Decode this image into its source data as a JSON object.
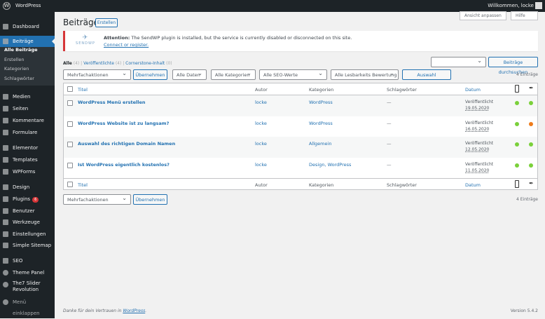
{
  "adminbar": {
    "site": "WordPress",
    "welcome": "Willkommen, locke"
  },
  "sidebar": {
    "items": [
      {
        "label": "Dashboard",
        "icon": "dashboard-icon"
      },
      {
        "label": "Beiträge",
        "icon": "pin-icon",
        "active": true
      },
      {
        "label": "Medien",
        "icon": "media-icon"
      },
      {
        "label": "Seiten",
        "icon": "page-icon"
      },
      {
        "label": "Kommentare",
        "icon": "comment-icon"
      },
      {
        "label": "Formulare",
        "icon": "form-icon"
      },
      {
        "label": "Elementor",
        "icon": "elementor-icon"
      },
      {
        "label": "Templates",
        "icon": "folder-icon"
      },
      {
        "label": "WPForms",
        "icon": "wpforms-icon"
      },
      {
        "label": "Design",
        "icon": "brush-icon"
      },
      {
        "label": "Plugins",
        "icon": "plugin-icon",
        "badge": "6"
      },
      {
        "label": "Benutzer",
        "icon": "user-icon"
      },
      {
        "label": "Werkzeuge",
        "icon": "wrench-icon"
      },
      {
        "label": "Einstellungen",
        "icon": "settings-icon"
      },
      {
        "label": "Simple Sitemap",
        "icon": "sitemap-icon"
      },
      {
        "label": "SEO",
        "icon": "seo-icon"
      },
      {
        "label": "Theme Panel",
        "icon": "gear-icon"
      },
      {
        "label": "The7 Slider Revolution",
        "icon": "slider-icon"
      },
      {
        "label": "Menü einklappen",
        "icon": "collapse-icon"
      }
    ],
    "submenu": [
      "Alle Beiträge",
      "Erstellen",
      "Kategorien",
      "Schlagwörter"
    ]
  },
  "header": {
    "title": "Beiträge",
    "add_new": "Erstellen",
    "screen_options": "Ansicht anpassen",
    "help": "Hilfe"
  },
  "notice": {
    "logo": "SENDWP",
    "strong": "Attention:",
    "text": "The SendWP plugin is installed, but the service is currently disabled or disconnected on this site.",
    "link": "Connect or register."
  },
  "views": [
    {
      "label": "Alle",
      "count": "(4)"
    },
    {
      "label": "Veröffentlichte",
      "count": "(4)"
    },
    {
      "label": "Cornerstone-Inhalt",
      "count": "(0)"
    }
  ],
  "search": {
    "value": "",
    "button": "Beiträge durchsuchen"
  },
  "filters": {
    "bulk": "Mehrfachaktionen",
    "apply": "Übernehmen",
    "dates": "Alle Daten",
    "cats": "Alle Kategorien",
    "seo": "Alle SEO-Werte",
    "readability": "Alle Lesbarkeits Bewertung",
    "filter": "Auswahl einschränken",
    "count": "4 Einträge"
  },
  "columns": {
    "title": "Titel",
    "author": "Autor",
    "categories": "Kategorien",
    "tags": "Schlagwörter",
    "date": "Datum"
  },
  "rows": [
    {
      "title": "WordPress Menü erstellen",
      "author": "locke",
      "categories": "WordPress",
      "tags": "—",
      "status": "Veröffentlicht",
      "date": "19.05.2020",
      "seo": "#7ad03a",
      "readability": "#7ad03a"
    },
    {
      "title": "WordPress Website ist zu langsam?",
      "author": "locke",
      "categories": "WordPress",
      "tags": "—",
      "status": "Veröffentlicht",
      "date": "16.05.2020",
      "seo": "#7ad03a",
      "readability": "#ee7c1b"
    },
    {
      "title": "Auswahl des richtigen Domain Namen",
      "author": "locke",
      "categories": "Allgemein",
      "tags": "—",
      "status": "Veröffentlicht",
      "date": "12.05.2020",
      "seo": "#7ad03a",
      "readability": "#7ad03a"
    },
    {
      "title": "Ist WordPress eigentlich kostenlos?",
      "author": "locke",
      "categories": "Design, WordPress",
      "tags": "—",
      "status": "Veröffentlicht",
      "date": "11.05.2020",
      "seo": "#7ad03a",
      "readability": "#7ad03a"
    }
  ],
  "footer": {
    "thanks": "Danke für dein Vertrauen in ",
    "wp": "WordPress",
    "dot": ".",
    "version": "Version 5.4.2"
  }
}
